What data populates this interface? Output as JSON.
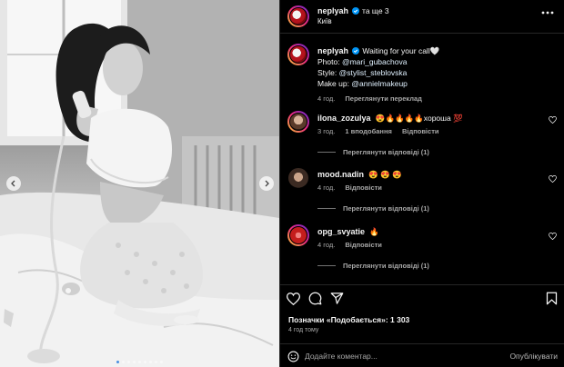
{
  "header": {
    "username": "neplyah",
    "with_more": "та ще 3",
    "location": "Київ"
  },
  "caption": {
    "username": "neplyah",
    "text": "Waiting for your call🤍",
    "photo_label": "Photo:",
    "photo_link": "@mari_gubachova",
    "style_label": "Style:",
    "style_link": "@stylist_steblovska",
    "makeup_label": "Make up:",
    "makeup_link": "@annielmakeup",
    "time": "4 год.",
    "translate": "Переглянути переклад"
  },
  "comments": [
    {
      "username": "ilona_zozulya",
      "text": "😍🔥🔥🔥🔥хороша 💯",
      "time": "3 год.",
      "likes": "1 вподобання",
      "reply": "Відповісти",
      "replies": "Переглянути відповіді (1)"
    },
    {
      "username": "mood.nadin",
      "text": "😍 😍 😍",
      "time": "4 год.",
      "reply": "Відповісти",
      "replies": "Переглянути відповіді (1)"
    },
    {
      "username": "opg_svyatie",
      "text": "🔥",
      "time": "4 год.",
      "reply": "Відповісти",
      "replies": "Переглянути відповіді (1)"
    }
  ],
  "footer": {
    "likes": "Позначки «Подобається»: 1 303",
    "time": "4 год тому",
    "comment_placeholder": "Додайте коментар...",
    "post": "Опублікувати"
  },
  "colors": {
    "accent": "#0095f6",
    "link": "#e0f1ff",
    "secondary_text": "#a8a8a8"
  },
  "carousel": {
    "slides": 9,
    "current": 1
  }
}
